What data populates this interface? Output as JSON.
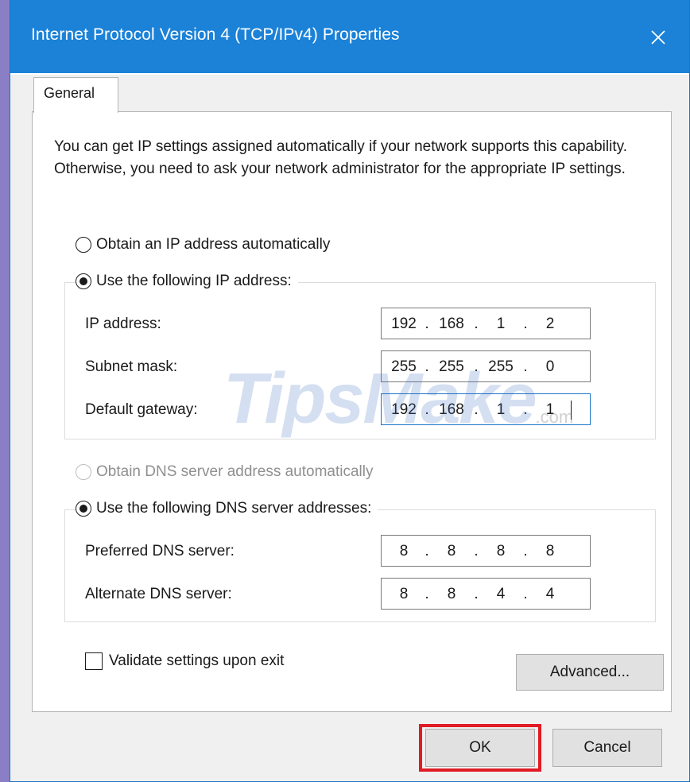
{
  "window": {
    "title": "Internet Protocol Version 4 (TCP/IPv4) Properties",
    "close_symbol": "✕"
  },
  "tabs": [
    {
      "label": "General",
      "selected": true
    }
  ],
  "general": {
    "description": "You can get IP settings assigned automatically if your network supports this capability. Otherwise, you need to ask your network administrator for the appropriate IP settings.",
    "ip_mode": {
      "auto_label": "Obtain an IP address automatically",
      "manual_label": "Use the following IP address:",
      "selected": "manual"
    },
    "ip_fields": [
      {
        "label": "IP address:",
        "octets": [
          "192",
          "168",
          "1",
          "2"
        ]
      },
      {
        "label": "Subnet mask:",
        "octets": [
          "255",
          "255",
          "255",
          "0"
        ]
      },
      {
        "label": "Default gateway:",
        "octets": [
          "192",
          "168",
          "1",
          "1"
        ],
        "focused": true
      }
    ],
    "dns_mode": {
      "auto_label": "Obtain DNS server address automatically",
      "auto_disabled": true,
      "manual_label": "Use the following DNS server addresses:",
      "selected": "manual"
    },
    "dns_fields": [
      {
        "label": "Preferred DNS server:",
        "octets": [
          "8",
          "8",
          "8",
          "8"
        ]
      },
      {
        "label": "Alternate DNS server:",
        "octets": [
          "8",
          "8",
          "4",
          "4"
        ]
      }
    ],
    "validate_label": "Validate settings upon exit",
    "validate_checked": false,
    "advanced_label": "Advanced..."
  },
  "footer": {
    "ok_label": "OK",
    "cancel_label": "Cancel"
  },
  "watermark": {
    "text": "TipsMake",
    "suffix": ".com"
  },
  "colors": {
    "titlebar": "#1b82d8",
    "highlight": "#e01b24"
  }
}
